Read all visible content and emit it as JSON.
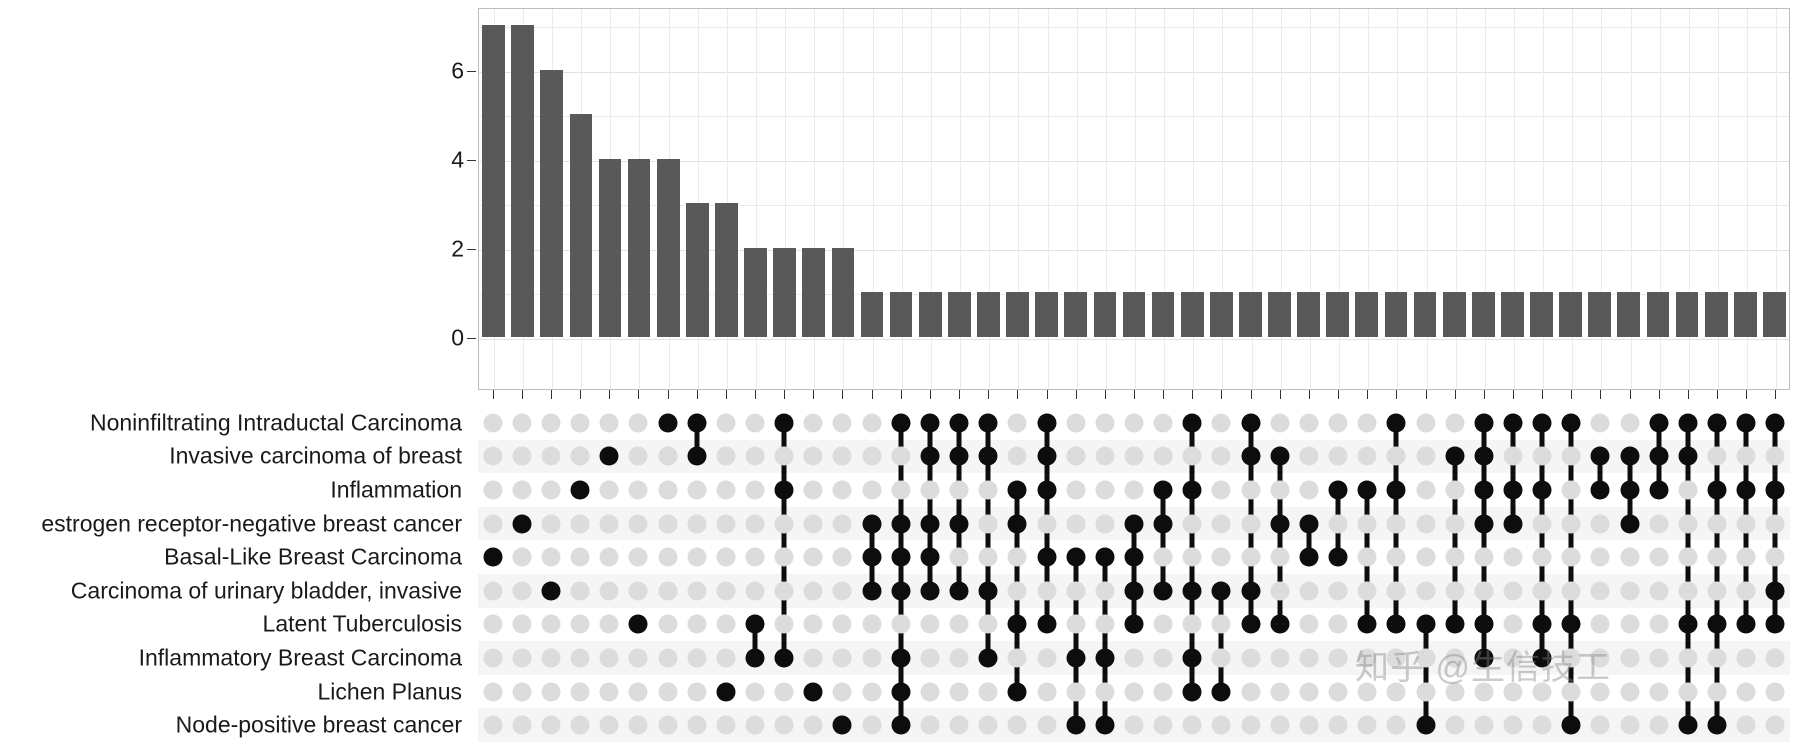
{
  "chart_data": {
    "type": "bar",
    "title": "",
    "subtitle": "",
    "xlabel": "",
    "ylabel": "",
    "grid": true,
    "legend_position": "none",
    "ylim": [
      0,
      7
    ],
    "y_ticks": [
      0,
      2,
      4,
      6
    ],
    "y_tick_labels": [
      "0",
      "2",
      "4",
      "6"
    ],
    "bar_color": "#595959",
    "dot_on_color": "#0d0d0d",
    "dot_off_color": "#dcdcdc",
    "n_intersections": 45,
    "categories": [
      "Noninfiltrating Intraductal Carcinoma",
      "Invasive carcinoma of breast",
      "Inflammation",
      "estrogen receptor-negative breast cancer",
      "Basal-Like Breast Carcinoma",
      "Carcinoma of urinary bladder, invasive",
      "Latent Tuberculosis",
      "Inflammatory Breast Carcinoma",
      "Lichen Planus",
      "Node-positive breast cancer"
    ],
    "values": [
      7,
      7,
      6,
      5,
      4,
      4,
      4,
      3,
      3,
      2,
      2,
      2,
      2,
      1,
      1,
      1,
      1,
      1,
      1,
      1,
      1,
      1,
      1,
      1,
      1,
      1,
      1,
      1,
      1,
      1,
      1,
      1,
      1,
      1,
      1,
      1,
      1,
      1,
      1,
      1,
      1,
      1,
      1,
      1,
      1
    ],
    "intersections": [
      {
        "size": 7,
        "members": [
          4
        ]
      },
      {
        "size": 7,
        "members": [
          3
        ]
      },
      {
        "size": 6,
        "members": [
          5
        ]
      },
      {
        "size": 5,
        "members": [
          2
        ]
      },
      {
        "size": 4,
        "members": [
          1
        ]
      },
      {
        "size": 4,
        "members": [
          6
        ]
      },
      {
        "size": 4,
        "members": [
          0
        ]
      },
      {
        "size": 3,
        "members": [
          0,
          1
        ]
      },
      {
        "size": 3,
        "members": [
          8
        ]
      },
      {
        "size": 2,
        "members": [
          6,
          7
        ]
      },
      {
        "size": 2,
        "members": [
          0,
          2,
          7
        ]
      },
      {
        "size": 2,
        "members": [
          8
        ]
      },
      {
        "size": 2,
        "members": [
          9
        ]
      },
      {
        "size": 1,
        "members": [
          3,
          4,
          5
        ]
      },
      {
        "size": 1,
        "members": [
          0,
          3,
          4,
          5,
          7,
          8,
          9
        ]
      },
      {
        "size": 1,
        "members": [
          0,
          1,
          3,
          4,
          5
        ]
      },
      {
        "size": 1,
        "members": [
          0,
          1,
          3,
          5
        ]
      },
      {
        "size": 1,
        "members": [
          0,
          1,
          5,
          7
        ]
      },
      {
        "size": 1,
        "members": [
          2,
          3,
          6,
          8
        ]
      },
      {
        "size": 1,
        "members": [
          0,
          1,
          2,
          4,
          6
        ]
      },
      {
        "size": 1,
        "members": [
          4,
          7,
          9
        ]
      },
      {
        "size": 1,
        "members": [
          4,
          7,
          9
        ]
      },
      {
        "size": 1,
        "members": [
          3,
          4,
          5,
          6
        ]
      },
      {
        "size": 1,
        "members": [
          2,
          3,
          5
        ]
      },
      {
        "size": 1,
        "members": [
          0,
          2,
          5,
          7,
          8
        ]
      },
      {
        "size": 1,
        "members": [
          5,
          8
        ]
      },
      {
        "size": 1,
        "members": [
          0,
          1,
          5,
          6
        ]
      },
      {
        "size": 1,
        "members": [
          1,
          3,
          6
        ]
      },
      {
        "size": 1,
        "members": [
          3,
          4
        ]
      },
      {
        "size": 1,
        "members": [
          2,
          4
        ]
      },
      {
        "size": 1,
        "members": [
          2,
          6
        ]
      },
      {
        "size": 1,
        "members": [
          0,
          2,
          6
        ]
      },
      {
        "size": 1,
        "members": [
          6,
          9
        ]
      },
      {
        "size": 1,
        "members": [
          1,
          6
        ]
      },
      {
        "size": 1,
        "members": [
          0,
          1,
          2,
          3,
          6,
          7
        ]
      },
      {
        "size": 1,
        "members": [
          0,
          2,
          3
        ]
      },
      {
        "size": 1,
        "members": [
          0,
          2,
          6,
          7
        ]
      },
      {
        "size": 1,
        "members": [
          0,
          6,
          9
        ]
      },
      {
        "size": 1,
        "members": [
          1,
          2
        ]
      },
      {
        "size": 1,
        "members": [
          1,
          2,
          3
        ]
      },
      {
        "size": 1,
        "members": [
          0,
          1,
          2
        ]
      },
      {
        "size": 1,
        "members": [
          0,
          1,
          6,
          9
        ]
      },
      {
        "size": 1,
        "members": [
          0,
          2,
          6,
          9
        ]
      },
      {
        "size": 1,
        "members": [
          0,
          2,
          6
        ]
      },
      {
        "size": 1,
        "members": [
          0,
          2,
          5,
          6
        ]
      }
    ]
  },
  "watermark": {
    "text": "知乎 @生信技工"
  }
}
